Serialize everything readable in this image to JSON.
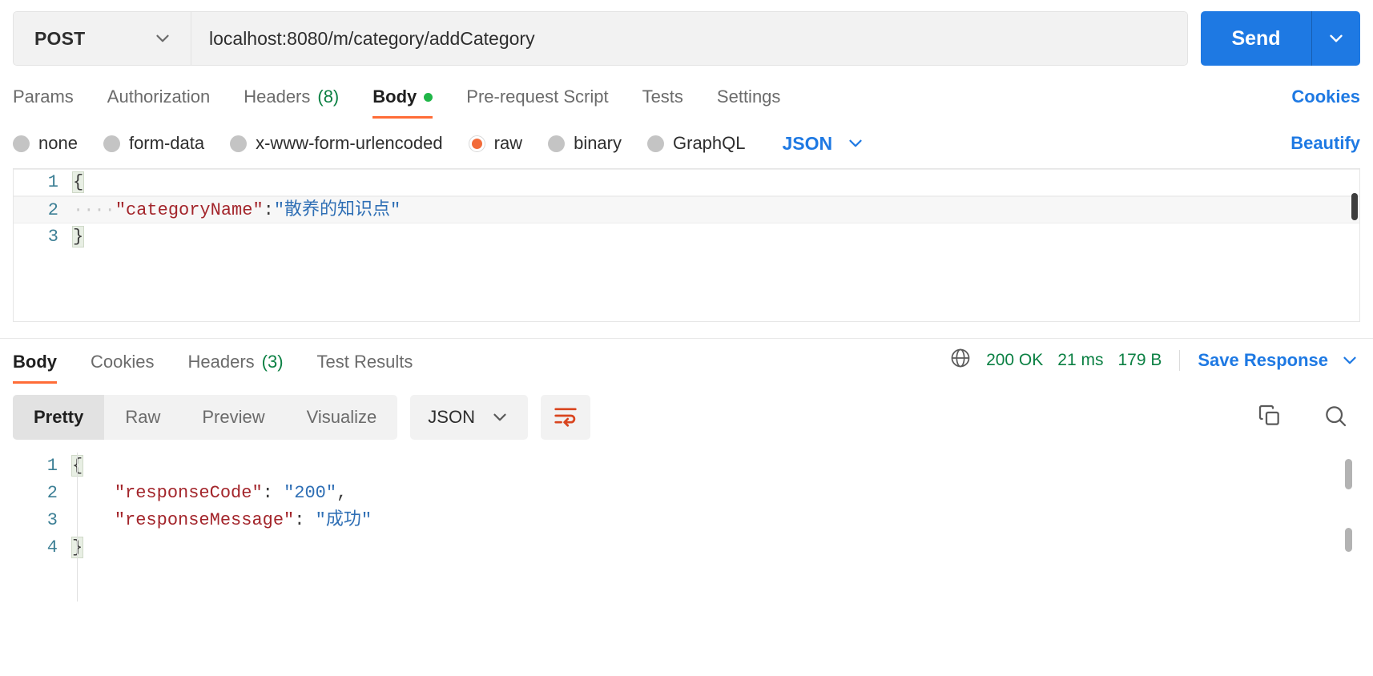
{
  "request": {
    "method": "POST",
    "url": "localhost:8080/m/category/addCategory",
    "send_label": "Send",
    "tabs": [
      {
        "label": "Params",
        "active": false
      },
      {
        "label": "Authorization",
        "active": false
      },
      {
        "label": "Headers",
        "count": "(8)",
        "active": false
      },
      {
        "label": "Body",
        "active": true,
        "dot": true
      },
      {
        "label": "Pre-request Script",
        "active": false
      },
      {
        "label": "Tests",
        "active": false
      },
      {
        "label": "Settings",
        "active": false
      }
    ],
    "cookies_label": "Cookies",
    "body_types": [
      {
        "label": "none",
        "selected": false
      },
      {
        "label": "form-data",
        "selected": false
      },
      {
        "label": "x-www-form-urlencoded",
        "selected": false
      },
      {
        "label": "raw",
        "selected": true
      },
      {
        "label": "binary",
        "selected": false
      },
      {
        "label": "GraphQL",
        "selected": false
      }
    ],
    "format_label": "JSON",
    "beautify_label": "Beautify",
    "body_lines": [
      {
        "num": "1",
        "brace": "{",
        "indent": "",
        "key": "",
        "colon": "",
        "value": ""
      },
      {
        "num": "2",
        "brace": "",
        "indent": "····",
        "key": "\"categoryName\"",
        "colon": ":",
        "value": "\"散养的知识点\""
      },
      {
        "num": "3",
        "brace": "}",
        "indent": "",
        "key": "",
        "colon": "",
        "value": ""
      }
    ]
  },
  "response": {
    "tabs": [
      {
        "label": "Body",
        "active": true
      },
      {
        "label": "Cookies",
        "active": false
      },
      {
        "label": "Headers",
        "count": "(3)",
        "active": false
      },
      {
        "label": "Test Results",
        "active": false
      }
    ],
    "status": "200 OK",
    "time": "21 ms",
    "size": "179 B",
    "save_label": "Save Response",
    "view_modes": [
      {
        "label": "Pretty",
        "active": true
      },
      {
        "label": "Raw",
        "active": false
      },
      {
        "label": "Preview",
        "active": false
      },
      {
        "label": "Visualize",
        "active": false
      }
    ],
    "format_label": "JSON",
    "body_lines": [
      {
        "num": "1",
        "brace": "{",
        "indent": "",
        "key": "",
        "colon": "",
        "value": "",
        "comma": ""
      },
      {
        "num": "2",
        "brace": "",
        "indent": "    ",
        "key": "\"responseCode\"",
        "colon": ": ",
        "value": "\"200\"",
        "comma": ","
      },
      {
        "num": "3",
        "brace": "",
        "indent": "    ",
        "key": "\"responseMessage\"",
        "colon": ": ",
        "value": "\"成功\"",
        "comma": ""
      },
      {
        "num": "4",
        "brace": "}",
        "indent": "",
        "key": "",
        "colon": "",
        "value": "",
        "comma": ""
      }
    ]
  },
  "colors": {
    "accent_orange": "#ff6c37",
    "link_blue": "#1e79e3",
    "status_green": "#0b8043",
    "json_key": "#a3252b",
    "json_string": "#2f6fb5",
    "gutter": "#3c7f95"
  }
}
